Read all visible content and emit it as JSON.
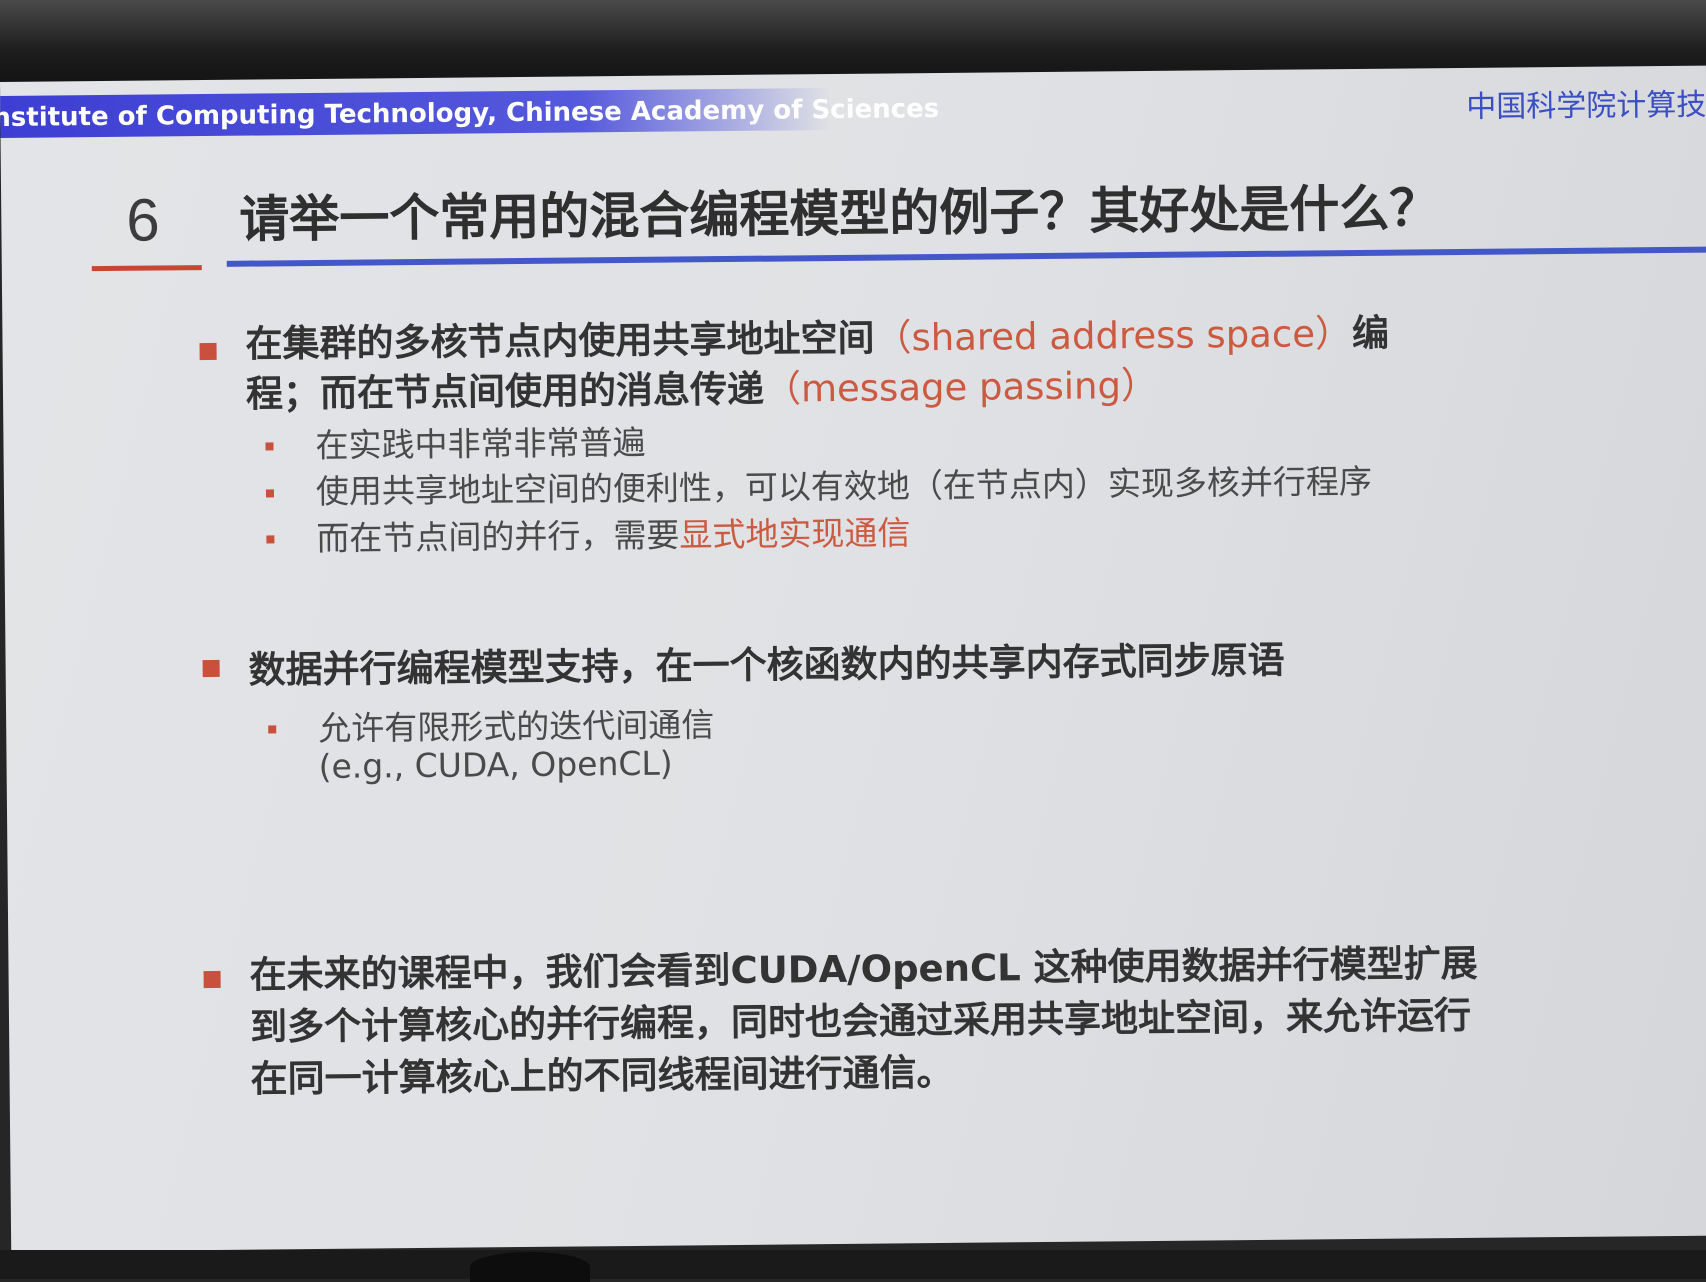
{
  "header": {
    "institute_en": "nstitute of Computing Technology, Chinese Academy of Sciences",
    "institute_cn": "中国科学院计算技",
    "accent_color": "#4457c8"
  },
  "question": {
    "number": "6",
    "title": "请举一个常用的混合编程模型的例子？其好处是什么？"
  },
  "bullets": [
    {
      "prefix": "在集群的多核节点内使用共享地址空间",
      "highlight1": "（shared address space）",
      "middle": "编程；而在节点间使用的消息传递",
      "highlight2": "（message passing）",
      "subs": [
        {
          "text": "在实践中非常非常普遍"
        },
        {
          "text": "使用共享地址空间的便利性，可以有效地（在节点内）实现多核并行程序"
        },
        {
          "text": "而在节点间的并行，需要",
          "highlight": "显式地实现通信"
        }
      ]
    },
    {
      "text": "数据并行编程模型支持，在一个核函数内的共享内存式同步原语",
      "subs": [
        {
          "text": "允许有限形式的迭代间通信"
        },
        {
          "text": "(e.g., CUDA, OpenCL)"
        }
      ]
    },
    {
      "text": "在未来的课程中，我们会看到CUDA/OpenCL 这种使用数据并行模型扩展到多个计算核心的并行编程，同时也会通过采用共享地址空间，来允许运行在同一计算核心上的不同线程间进行通信。"
    }
  ],
  "colors": {
    "bullet": "#c8503c",
    "highlight": "#cc5a40",
    "header_band": "#3d3ed3"
  }
}
